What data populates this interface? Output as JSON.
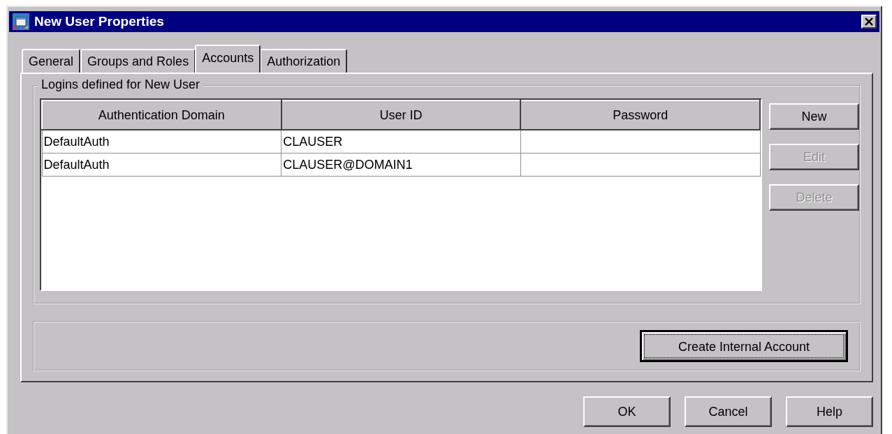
{
  "window": {
    "title": "New User Properties"
  },
  "tabs": [
    {
      "label": "General",
      "selected": false
    },
    {
      "label": "Groups and Roles",
      "selected": false
    },
    {
      "label": "Accounts",
      "selected": true
    },
    {
      "label": "Authorization",
      "selected": false
    }
  ],
  "logins": {
    "legend": "Logins defined for New User",
    "table": {
      "columns": [
        "Authentication Domain",
        "User ID",
        "Password"
      ],
      "rows": [
        [
          "DefaultAuth",
          "CLAUSER",
          ""
        ],
        [
          "DefaultAuth",
          "CLAUSER@DOMAIN1",
          ""
        ]
      ]
    },
    "buttons": [
      {
        "label": "New",
        "disabled": false
      },
      {
        "label": "Edit",
        "disabled": true
      },
      {
        "label": "Delete",
        "disabled": true
      }
    ]
  },
  "internal_account_button": {
    "label": "Create Internal Account",
    "focused": true
  },
  "footer_buttons": [
    {
      "label": "OK",
      "disabled": false
    },
    {
      "label": "Cancel",
      "disabled": false
    },
    {
      "label": "Help",
      "disabled": false
    }
  ]
}
